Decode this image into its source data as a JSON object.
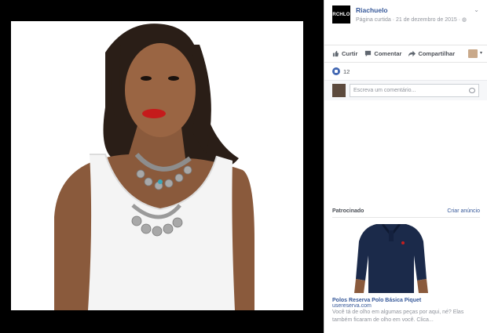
{
  "post": {
    "page_name": "Riachuelo",
    "avatar_text": "RCHLO",
    "meta": "Página curtida · 21 de dezembro de 2015 · ",
    "chevron": "⌄"
  },
  "actions": {
    "like": "Curtir",
    "comment": "Comentar",
    "share": "Compartilhar",
    "caret": "▾"
  },
  "reactions": {
    "count": "12"
  },
  "comment_input": {
    "placeholder": "Escreva um comentário..."
  },
  "sponsored": {
    "title": "Patrocinado",
    "create": "Criar anúncio",
    "ad_name": "Polos Reserva Polo Básica Piquet",
    "ad_url": "usereserva.com",
    "ad_desc": "Você tá de olho em algumas peças por aqui, né? Elas também ficaram de olho em você. Clica..."
  },
  "colors": {
    "link": "#365899",
    "like": "#4267b2",
    "lipstick": "#c51b1b"
  }
}
